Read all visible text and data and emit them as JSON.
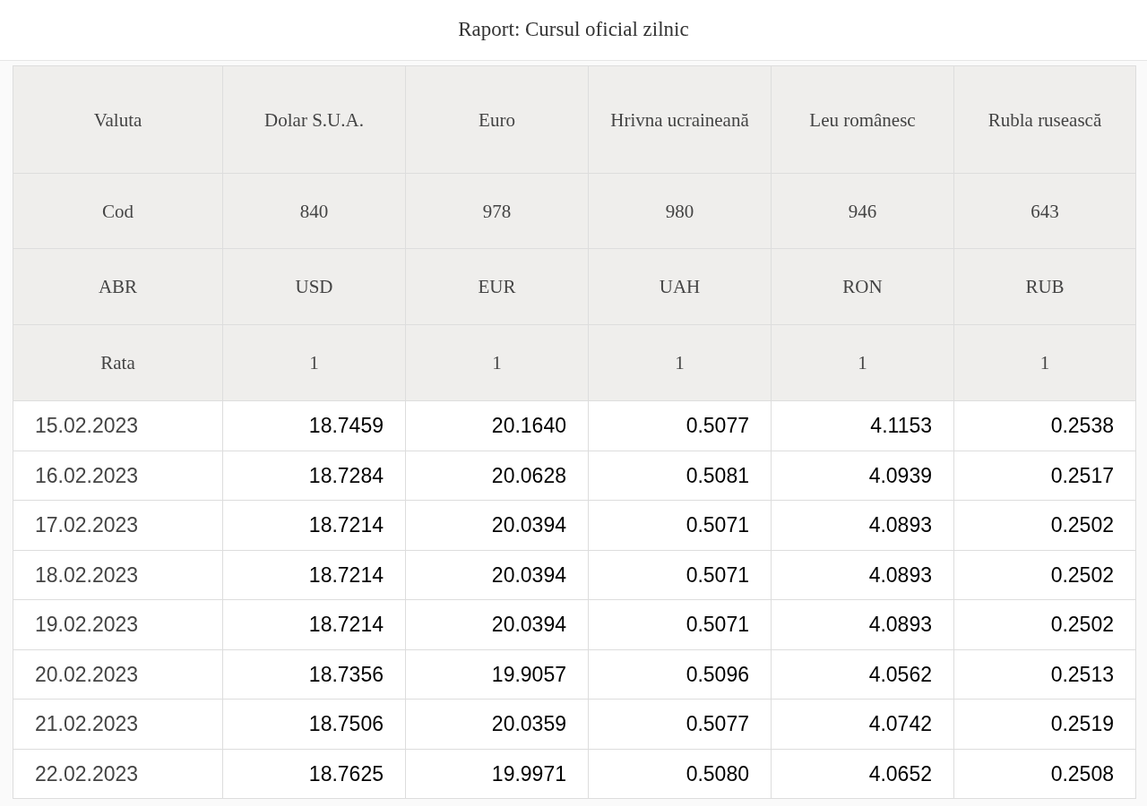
{
  "title": "Raport: Cursul oficial zilnic",
  "header_rows": [
    {
      "label": "Valuta",
      "cells": [
        "Dolar S.U.A.",
        "Euro",
        "Hrivna ucraineană",
        "Leu românesc",
        "Rubla rusească"
      ]
    },
    {
      "label": "Cod",
      "cells": [
        "840",
        "978",
        "980",
        "946",
        "643"
      ]
    },
    {
      "label": "ABR",
      "cells": [
        "USD",
        "EUR",
        "UAH",
        "RON",
        "RUB"
      ]
    },
    {
      "label": "Rata",
      "cells": [
        "1",
        "1",
        "1",
        "1",
        "1"
      ]
    }
  ],
  "rows": [
    {
      "date": "15.02.2023",
      "values": [
        "18.7459",
        "20.1640",
        "0.5077",
        "4.1153",
        "0.2538"
      ]
    },
    {
      "date": "16.02.2023",
      "values": [
        "18.7284",
        "20.0628",
        "0.5081",
        "4.0939",
        "0.2517"
      ]
    },
    {
      "date": "17.02.2023",
      "values": [
        "18.7214",
        "20.0394",
        "0.5071",
        "4.0893",
        "0.2502"
      ]
    },
    {
      "date": "18.02.2023",
      "values": [
        "18.7214",
        "20.0394",
        "0.5071",
        "4.0893",
        "0.2502"
      ]
    },
    {
      "date": "19.02.2023",
      "values": [
        "18.7214",
        "20.0394",
        "0.5071",
        "4.0893",
        "0.2502"
      ]
    },
    {
      "date": "20.02.2023",
      "values": [
        "18.7356",
        "19.9057",
        "0.5096",
        "4.0562",
        "0.2513"
      ]
    },
    {
      "date": "21.02.2023",
      "values": [
        "18.7506",
        "20.0359",
        "0.5077",
        "4.0742",
        "0.2519"
      ]
    },
    {
      "date": "22.02.2023",
      "values": [
        "18.7625",
        "19.9971",
        "0.5080",
        "4.0652",
        "0.2508"
      ]
    }
  ]
}
